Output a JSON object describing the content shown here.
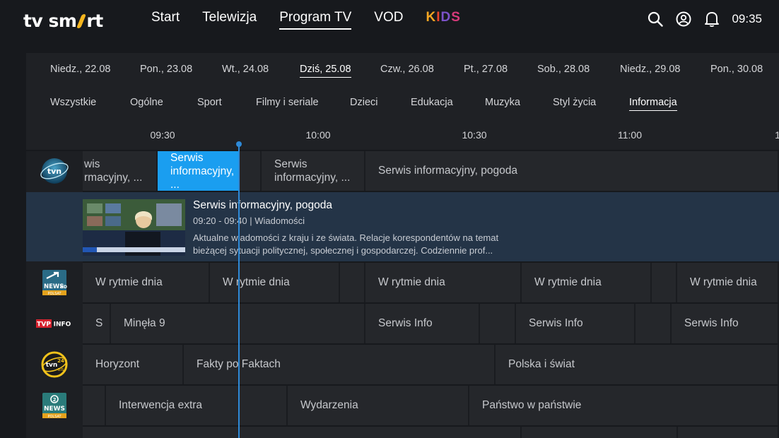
{
  "brand": {
    "logo_text_a": "tv sm",
    "logo_text_b": "rt",
    "accent": "#f5b51e"
  },
  "nav": {
    "start": "Start",
    "telewizja": "Telewizja",
    "program_tv": "Program TV",
    "vod": "VOD",
    "kids": [
      "K",
      "I",
      "D",
      "S"
    ]
  },
  "header": {
    "clock": "09:35",
    "icons": [
      "search-icon",
      "profile-icon",
      "bell-icon"
    ]
  },
  "days": [
    "Niedz., 22.08",
    "Pon., 23.08",
    "Wt., 24.08",
    "Dziś, 25.08",
    "Czw., 26.08",
    "Pt., 27.08",
    "Sob., 28.08",
    "Niedz., 29.08",
    "Pon., 30.08"
  ],
  "active_day": "Dziś, 25.08",
  "categories": [
    "Wszystkie",
    "Ogólne",
    "Sport",
    "Filmy i seriale",
    "Dzieci",
    "Edukacja",
    "Muzyka",
    "Styl życia",
    "Informacja"
  ],
  "active_category": "Informacja",
  "timeline": [
    "09:30",
    "10:00",
    "10:30",
    "11:00",
    "1"
  ],
  "channels": [
    {
      "name": "TVN",
      "programs": [
        {
          "line1": "wis",
          "line2": "rmacyjny, ..."
        },
        {
          "line1": "Serwis",
          "line2": "informacyjny, ..."
        },
        {
          "line1": "Serwis",
          "line2": "informacyjny, ..."
        },
        {
          "line1": "Serwis informacyjny, pogoda",
          "line2": ""
        }
      ]
    },
    {
      "name": "Polsat News HD",
      "programs": [
        "W rytmie dnia",
        "W rytmie dnia",
        "",
        "W rytmie dnia",
        "W rytmie dnia",
        "",
        "W rytmie dnia"
      ]
    },
    {
      "name": "TVP Info",
      "programs": [
        "S",
        "Minęła 9",
        "Serwis Info",
        "",
        "Serwis Info",
        "",
        "Serwis Info"
      ]
    },
    {
      "name": "TVN24 BiS",
      "programs": [
        "Horyzont",
        "Fakty po Faktach",
        "Polska i świat"
      ]
    },
    {
      "name": "Polsat News 2",
      "programs": [
        "",
        "Interwencja extra",
        "Wydarzenia",
        "Państwo w państwie"
      ]
    }
  ],
  "detail": {
    "title": "Serwis informacyjny, pogoda",
    "meta": "09:20 - 09:40 | Wiadomości",
    "description": "Aktualne wiadomości z kraju i ze świata. Relacje korespondentów na temat bieżącej sytuacji politycznej, społecznej i gospodarczej. Codziennie prof..."
  },
  "channel_logos": {
    "tvn": "tvn",
    "polsat_news": "NEWS",
    "polsat_news_hd": "HD",
    "polsat_sub": "POLSAT",
    "tvp_a": "TVP",
    "tvp_b": "INFO",
    "tvn24_a": "tvn",
    "tvn24_b": "24",
    "tvn24_c": "BiS",
    "news2_num": "2",
    "news2_word": "NEWS",
    "news2_sub": "POLSAT"
  },
  "colors": {
    "selected": "#1a9ef0",
    "now_line": "#2e8ad8",
    "detail_bg": "#243447"
  }
}
